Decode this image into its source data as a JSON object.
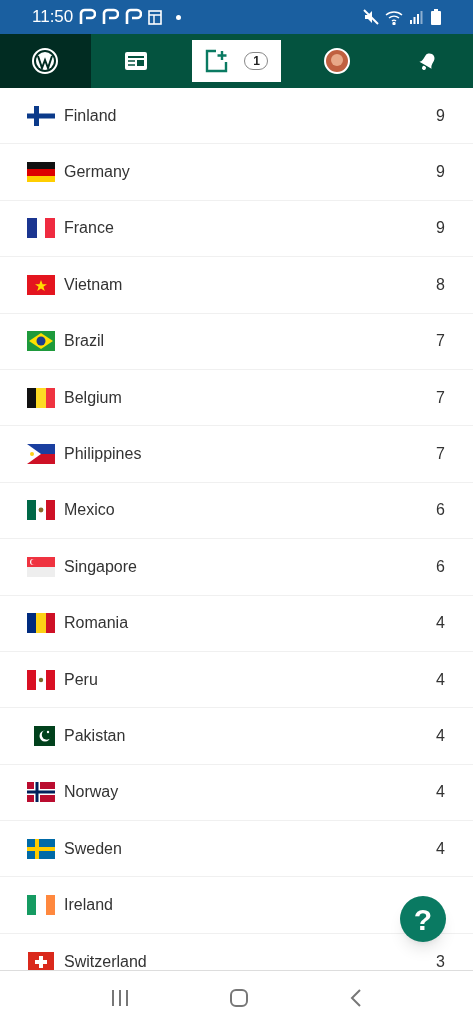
{
  "status_bar": {
    "time": "11:50"
  },
  "tabs": [
    {
      "kind": "site",
      "selected": false
    },
    {
      "kind": "reader",
      "selected": false
    },
    {
      "kind": "new-post",
      "selected": true,
      "badge": "1"
    },
    {
      "kind": "profile",
      "selected": false
    },
    {
      "kind": "notifications",
      "selected": false
    }
  ],
  "countries": [
    {
      "name": "Finland",
      "count": "9"
    },
    {
      "name": "Germany",
      "count": "9"
    },
    {
      "name": "France",
      "count": "9"
    },
    {
      "name": "Vietnam",
      "count": "8"
    },
    {
      "name": "Brazil",
      "count": "7"
    },
    {
      "name": "Belgium",
      "count": "7"
    },
    {
      "name": "Philippines",
      "count": "7"
    },
    {
      "name": "Mexico",
      "count": "6"
    },
    {
      "name": "Singapore",
      "count": "6"
    },
    {
      "name": "Romania",
      "count": "4"
    },
    {
      "name": "Peru",
      "count": "4"
    },
    {
      "name": "Pakistan",
      "count": "4"
    },
    {
      "name": "Norway",
      "count": "4"
    },
    {
      "name": "Sweden",
      "count": "4"
    },
    {
      "name": "Ireland"
    },
    {
      "name": "Switzerland",
      "count": "3"
    }
  ],
  "help_button": {
    "label": "?"
  }
}
